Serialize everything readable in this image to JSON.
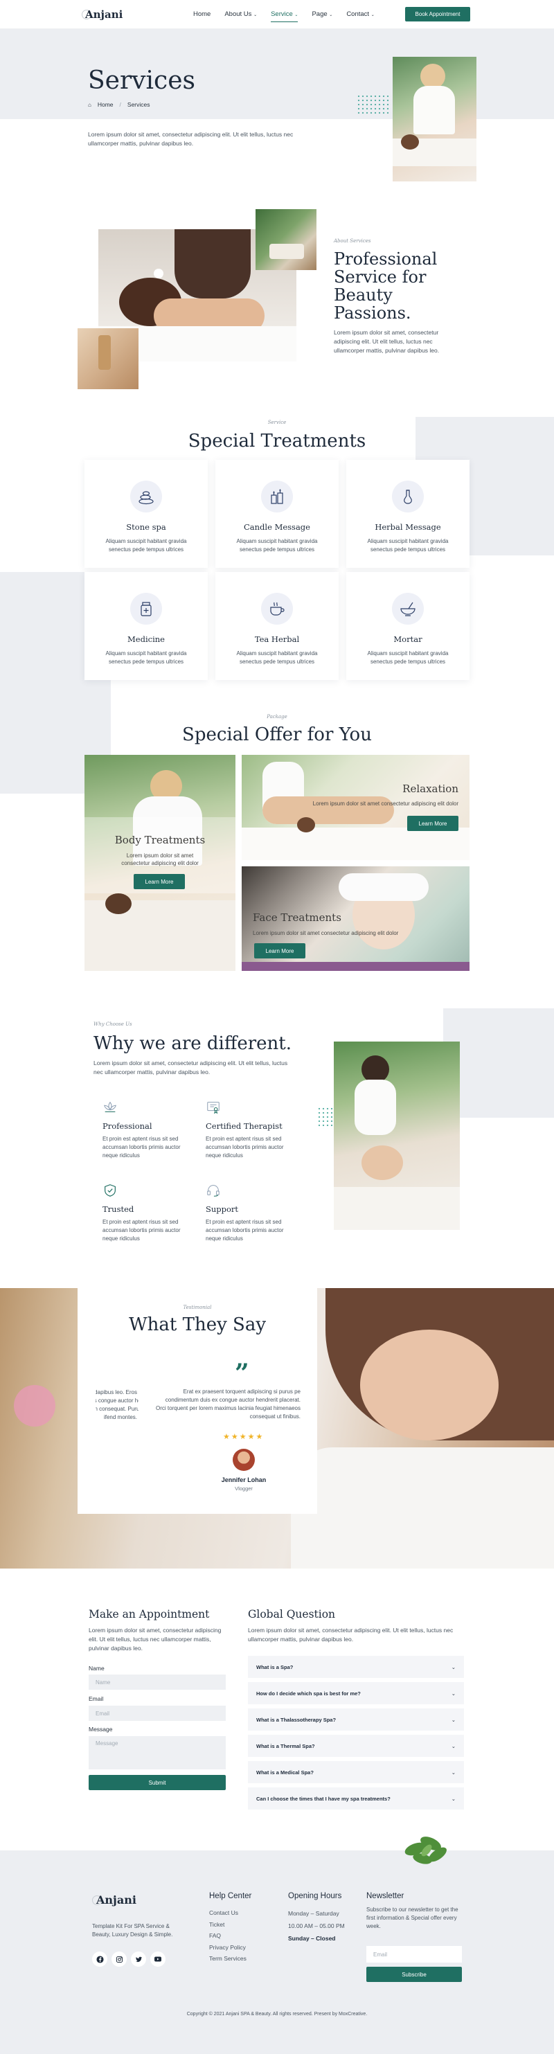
{
  "header": {
    "logo_name": "Anjani",
    "nav": [
      {
        "label": "Home"
      },
      {
        "label": "About Us",
        "chevron": true
      },
      {
        "label": "Service",
        "chevron": true,
        "active": true
      },
      {
        "label": "Page",
        "chevron": true
      },
      {
        "label": "Contact",
        "chevron": true
      }
    ],
    "cta": "Book Appointment"
  },
  "hero": {
    "title": "Services",
    "breadcrumb_home": "Home",
    "breadcrumb_sep": "/",
    "breadcrumb_current": "Services",
    "text": "Lorem ipsum dolor sit amet, consectetur adipiscing elit. Ut elit tellus, luctus nec ullamcorper mattis, pulvinar dapibus leo."
  },
  "about": {
    "tag": "About Services",
    "title": "Professional Service for Beauty Passions.",
    "text": "Lorem ipsum dolor sit amet, consectetur adipiscing elit. Ut elit tellus, luctus nec ullamcorper mattis, pulvinar dapibus leo."
  },
  "treatments": {
    "tag": "Service",
    "title": "Special Treatments",
    "items": [
      {
        "title": "Stone spa",
        "text": "Aliquam suscipit habitant gravida senectus pede tempus ultrices",
        "icon": "stones-icon"
      },
      {
        "title": "Candle Message",
        "text": "Aliquam suscipit habitant gravida senectus pede tempus ultrices",
        "icon": "candle-icon"
      },
      {
        "title": "Herbal Message",
        "text": "Aliquam suscipit habitant gravida senectus pede tempus ultrices",
        "icon": "herbal-icon"
      },
      {
        "title": "Medicine",
        "text": "Aliquam suscipit habitant gravida senectus pede tempus ultrices",
        "icon": "medicine-jar-icon"
      },
      {
        "title": "Tea Herbal",
        "text": "Aliquam suscipit habitant gravida senectus pede tempus ultrices",
        "icon": "tea-cup-icon"
      },
      {
        "title": "Mortar",
        "text": "Aliquam suscipit habitant gravida senectus pede tempus ultrices",
        "icon": "mortar-icon"
      }
    ]
  },
  "offer": {
    "tag": "Package",
    "title": "Special Offer for You",
    "body": {
      "title": "Body Treatments",
      "text": "Lorem ipsum dolor sit amet consectetur adipiscing elit dolor",
      "button": "Learn More"
    },
    "relax": {
      "title": "Relaxation",
      "text": "Lorem ipsum dolor sit amet consectetur adipiscing elit dolor",
      "button": "Learn More"
    },
    "face": {
      "title": "Face Treatments",
      "text": "Lorem ipsum dolor sit amet consectetur adipiscing elit dolor",
      "button": "Learn More"
    }
  },
  "why": {
    "tag": "Why Choose Us",
    "title": "Why we are different.",
    "text": "Lorem ipsum dolor sit amet, consectetur adipiscing elit. Ut elit tellus, luctus nec ullamcorper mattis, pulvinar dapibus leo.",
    "items": [
      {
        "title": "Professional",
        "text": "Et proin est aptent risus sit sed accumsan lobortis primis auctor neque ridiculus",
        "icon": "lotus-icon"
      },
      {
        "title": "Certified Therapist",
        "text": "Et proin est aptent risus sit sed accumsan lobortis primis auctor neque ridiculus",
        "icon": "certificate-icon"
      },
      {
        "title": "Trusted",
        "text": "Et proin est aptent risus sit sed accumsan lobortis primis auctor neque ridiculus",
        "icon": "shield-check-icon"
      },
      {
        "title": "Support",
        "text": "Et proin est aptent risus sit sed accumsan lobortis primis auctor neque ridiculus",
        "icon": "headset-icon"
      }
    ]
  },
  "testimonial": {
    "tag": "Testimonial",
    "title": "What They Say",
    "side_text_lines": [
      "ulvinar dapibus leo. Eros",
      "endimentum duis es congue auctor hendrerit ornare",
      "urabitur primis quam consequat. Purus diam",
      "ifend montes."
    ],
    "quote": "Erat ex praesent torquent adipiscing si purus pe condimentum duis ex congue auctor hendrerit placerat. Orci torquent per lorem maximus lacinia feugiat himenaeos consequat ut finibus.",
    "stars": "★★★★★",
    "name": "Jennifer Lohan",
    "role": "Vlogger"
  },
  "appointment": {
    "title": "Make an Appointment",
    "text": "Lorem ipsum dolor sit amet, consectetur adipiscing elit. Ut elit tellus, luctus nec ullamcorper mattis, pulvinar dapibus leo.",
    "name_label": "Name",
    "name_placeholder": "Name",
    "email_label": "Email",
    "email_placeholder": "Email",
    "message_label": "Message",
    "message_placeholder": "Message",
    "submit": "Submit"
  },
  "faq": {
    "title": "Global Question",
    "text": "Lorem ipsum dolor sit amet, consectetur adipiscing elit. Ut elit tellus, luctus nec ullamcorper mattis, pulvinar dapibus leo.",
    "items": [
      "What is a Spa?",
      "How do I decide which spa is best for me?",
      "What is a Thalassotherapy Spa?",
      "What is a Thermal Spa?",
      "What is a Medical Spa?",
      "Can I choose the times that I have my spa treatments?"
    ]
  },
  "footer": {
    "logo_name": "Anjani",
    "about": "Template Kit For SPA Service & Beauty, Luxury Design & Simple.",
    "help_title": "Help Center",
    "help_links": [
      "Contact Us",
      "Ticket",
      "FAQ",
      "Privacy Policy",
      "Term Services"
    ],
    "hours_title": "Opening Hours",
    "hours_days": "Monday – Saturday",
    "hours_time": "10.00 AM – 05.00 PM",
    "hours_closed": "Sunday – Closed",
    "news_title": "Newsletter",
    "news_text": "Subscribe to our newsletter to get the first information & Special offer every week.",
    "email_placeholder": "Email",
    "subscribe": "Subscribe",
    "copyright": "Copyright © 2021 Anjani SPA & Beauty. All rights reserved. Present by MoxCreative."
  },
  "colors": {
    "accent": "#1f6f62",
    "heading": "#1e2a3a",
    "light_bg": "#eceef2",
    "star": "#f0b429"
  }
}
